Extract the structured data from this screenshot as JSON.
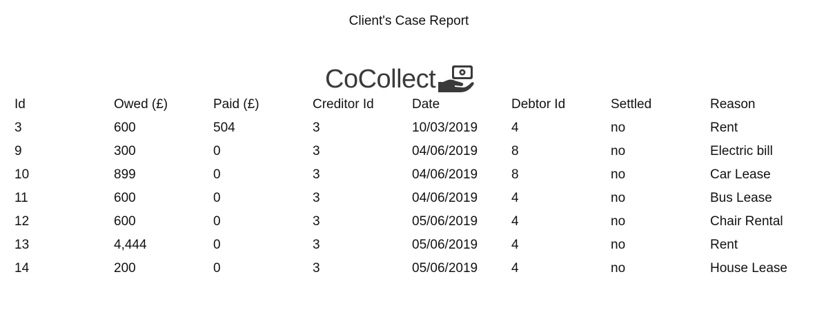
{
  "report": {
    "title": "Client's Case Report"
  },
  "logo": {
    "text": "CoCollect",
    "icon": "hand-holding-cash-icon",
    "color": "#3a3a3a"
  },
  "table": {
    "headers": [
      "Id",
      "Owed (£)",
      "Paid (£)",
      "Creditor Id",
      "Date",
      "Debtor Id",
      "Settled",
      "Reason"
    ],
    "rows": [
      [
        "3",
        "600",
        "504",
        "3",
        "10/03/2019",
        "4",
        "no",
        "Rent"
      ],
      [
        "9",
        "300",
        "0",
        "3",
        "04/06/2019",
        "8",
        "no",
        "Electric bill"
      ],
      [
        "10",
        "899",
        "0",
        "3",
        "04/06/2019",
        "8",
        "no",
        "Car Lease"
      ],
      [
        "11",
        "600",
        "0",
        "3",
        "04/06/2019",
        "4",
        "no",
        "Bus Lease"
      ],
      [
        "12",
        "600",
        "0",
        "3",
        "05/06/2019",
        "4",
        "no",
        "Chair Rental"
      ],
      [
        "13",
        "4,444",
        "0",
        "3",
        "05/06/2019",
        "4",
        "no",
        "Rent"
      ],
      [
        "14",
        "200",
        "0",
        "3",
        "05/06/2019",
        "4",
        "no",
        "House Lease"
      ]
    ]
  }
}
